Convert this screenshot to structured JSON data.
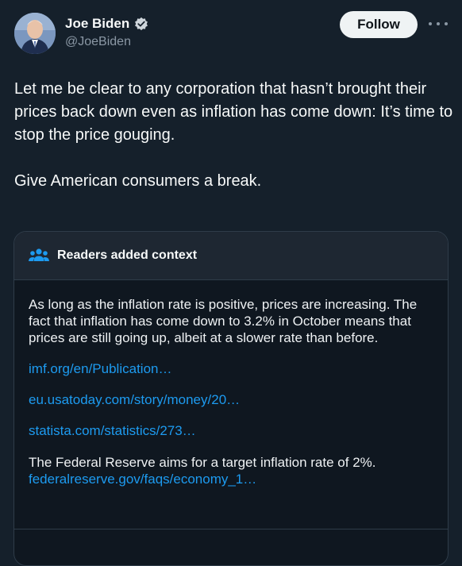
{
  "author": {
    "name": "Joe Biden",
    "handle": "@JoeBiden"
  },
  "follow_label": "Follow",
  "tweet": {
    "text": "Let me be clear to any corporation that hasn’t brought their prices back down even as inflation has come down: It’s time to stop the price gouging.\n\nGive American consumers a break."
  },
  "community_note": {
    "title": "Readers added context",
    "body": "As long as the inflation rate is positive, prices are increasing. The fact that inflation has come down to 3.2% in October means that prices are still going up, albeit at a slower rate than before.",
    "links": [
      "imf.org/en/Publication…",
      "eu.usatoday.com/story/money/20…",
      "statista.com/statistics/273…"
    ],
    "extra_text": "The Federal Reserve aims for a target inflation rate of 2%.",
    "extra_link": "federalreserve.gov/faqs/economy_1…"
  },
  "colors": {
    "background": "#15202b",
    "accent": "#1d9bf0",
    "text": "#f7f9f9",
    "muted": "#8b98a5"
  }
}
